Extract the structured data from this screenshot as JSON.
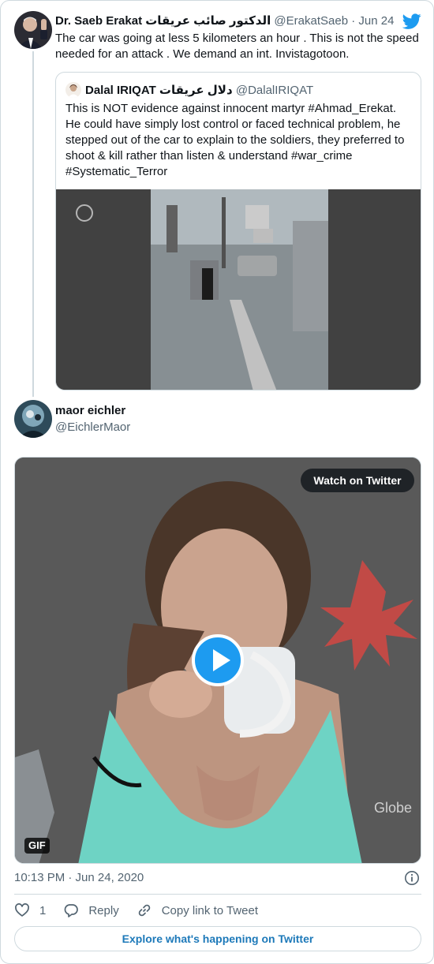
{
  "tweet": {
    "author_name": "Dr. Saeb Erakat الدكتور صائب عريقات",
    "author_handle": "@ErakatSaeb",
    "separator": " · ",
    "date": "Jun 24, 2020",
    "text": "The car was going at less 5 kilometers an hour . This is not the speed needed for an attack . We demand an int. Invistagotoon."
  },
  "quoted_tweet": {
    "author_name": "Dalal IRIQAT دلال عريقات",
    "author_handle": "@DalalIRIQAT",
    "text": "This is NOT evidence against innocent martyr #Ahmad_Erekat. He could have simply lost control or faced technical problem, he stepped out of the car to explain to the soldiers, they preferred to shoot & kill rather than listen & understand #war_crime #Systematic_Terror"
  },
  "reply": {
    "author_name": "maor eichler",
    "author_handle": "@EichlerMaor",
    "watch_label": "Watch on Twitter",
    "gif_badge": "GIF",
    "timestamp": "10:13 PM · Jun 24, 2020",
    "like_count": "1",
    "reply_label": "Reply",
    "copy_link_label": "Copy link to Tweet",
    "explore_label": "Explore what's happening on Twitter"
  },
  "colors": {
    "accent": "#1d9bf0",
    "link": "#1d79b9",
    "muted": "#536471",
    "border": "#cfd9de"
  },
  "icons": [
    "twitter-bird-icon",
    "play-icon",
    "info-icon",
    "heart-icon",
    "reply-icon",
    "link-icon"
  ]
}
